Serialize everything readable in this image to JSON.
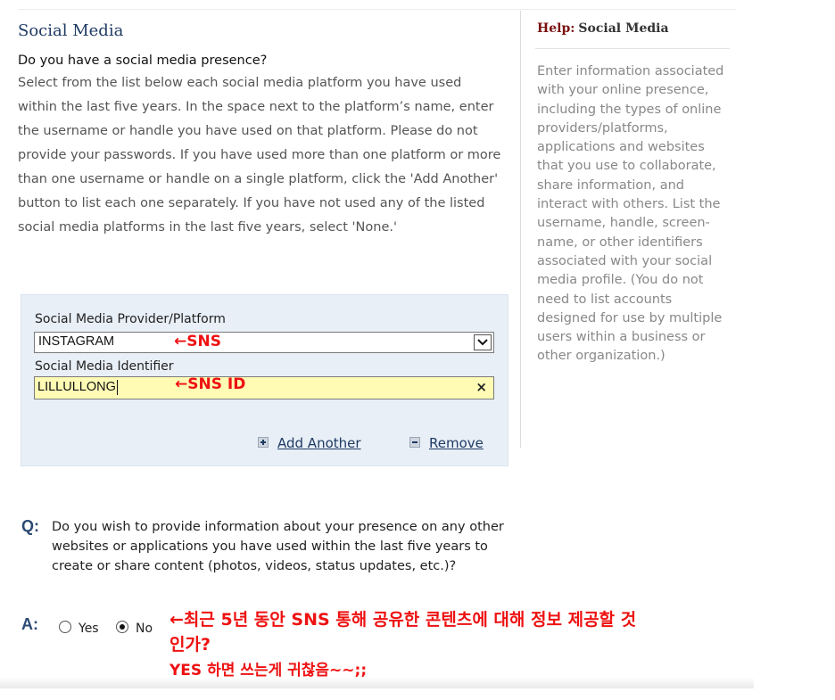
{
  "section": {
    "title": "Social Media",
    "question": "Do you have a social media presence?",
    "instructions": "Select from the list below each social media platform you have used within the last five years. In the space next to the platform’s name, enter the username or handle you have used on that platform. Please do not provide your passwords. If you have used more than one platform or more than one username or handle on a single platform, click the 'Add Another' button to list each one separately. If you have not used any of the listed social media platforms in the last five years, select 'None.'"
  },
  "help": {
    "label": "Help:",
    "title": "Social Media",
    "text": "Enter information associated with your online presence, including the types of online providers/platforms, applications and websites that you use to collaborate, share information, and interact with others. List the username, handle, screen-name, or other identifiers associated with your social media profile. (You do not need to list accounts designed for use by multiple users within a business or other organization.)"
  },
  "form": {
    "platform_label": "Social Media Provider/Platform",
    "platform_value": "INSTAGRAM",
    "identifier_label": "Social Media Identifier",
    "identifier_value": "LILLULLONG",
    "clear_symbol": "×",
    "add_another": "Add Another",
    "remove": "Remove"
  },
  "annotations": {
    "sns": "←SNS",
    "sns_id": "←SNS ID",
    "note_line1": "←최근 5년 동안 SNS 통해 공유한 콘텐츠에 대해 정보 제공할 것",
    "note_line2": "인가?",
    "note_line3": "YES 하면 쓰는게 귀찮음~~;;",
    "color": "#ee1111"
  },
  "question2": {
    "q_letter": "Q:",
    "text": "Do you wish to provide information about your presence on any other websites or applications you have used within the last five years to create or share content (photos, videos, status updates, etc.)?",
    "a_letter": "A:",
    "options": [
      {
        "label": "Yes",
        "selected": false
      },
      {
        "label": "No",
        "selected": true
      }
    ]
  },
  "colors": {
    "heading": "#1f3a63",
    "help_label": "#7a1010",
    "form_bg": "#e8eff7",
    "identifier_bg": "#fffbb5"
  }
}
